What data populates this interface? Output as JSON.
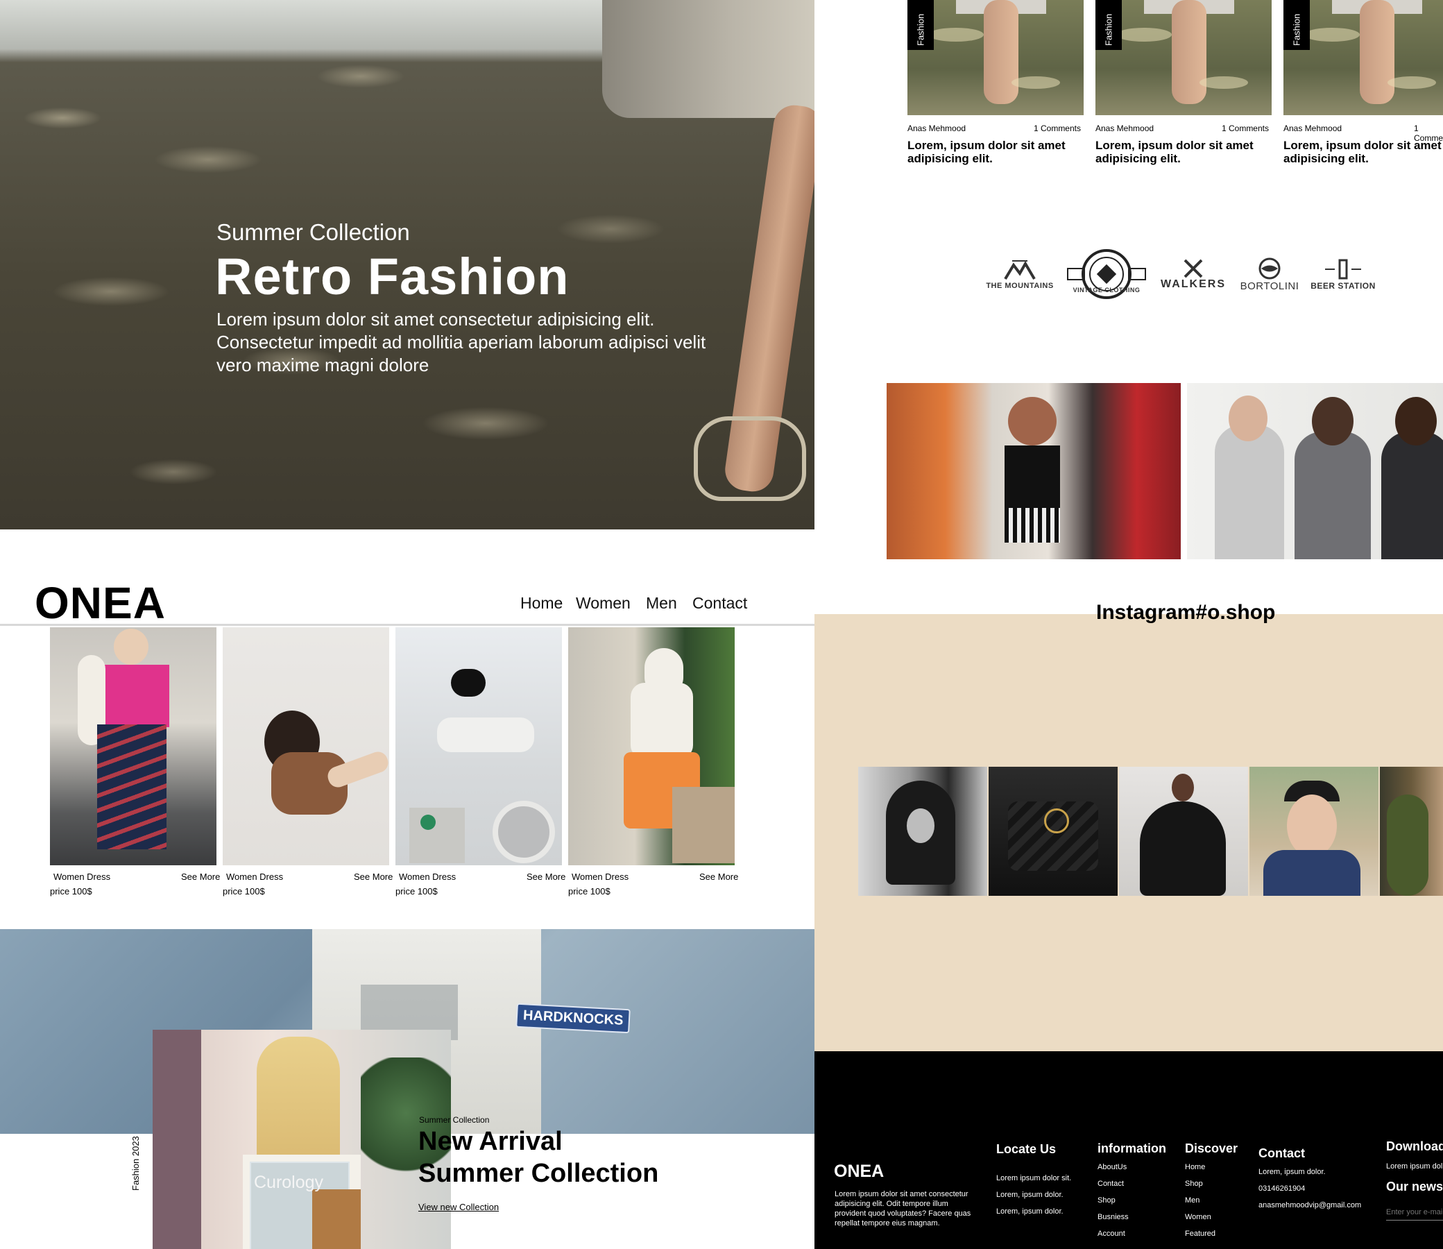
{
  "hero": {
    "kicker": "Summer Collection",
    "title": "Retro Fashion",
    "description": "Lorem ipsum dolor sit amet consectetur adipisicing elit. Consectetur impedit ad mollitia aperiam laborum adipisci velit vero maxime magni dolore"
  },
  "blog": {
    "cards": [
      {
        "tag": "Fashion",
        "author": "Anas Mehmood",
        "comments": "1 Comments",
        "title": "Lorem, ipsum dolor sit amet adipisicing elit."
      },
      {
        "tag": "Fashion",
        "author": "Anas Mehmood",
        "comments": "1 Comments",
        "title": "Lorem, ipsum dolor sit amet adipisicing elit."
      },
      {
        "tag": "Fashion",
        "author": "Anas Mehmood",
        "comments": "1 Comme",
        "title": "Lorem, ipsum dolor sit amet adipisicing elit."
      }
    ]
  },
  "brands": [
    {
      "name": "THE MOUNTAINS",
      "icon": "mountains-logo-icon"
    },
    {
      "name": "VINTAGE CLOTHING",
      "icon": "vintage-clothing-logo-icon"
    },
    {
      "name": "WALKERS",
      "icon": "walkers-logo-icon"
    },
    {
      "name": "BORTOLINI",
      "icon": "bortolini-logo-icon"
    },
    {
      "name": "BEER STATION",
      "icon": "beer-station-logo-icon"
    }
  ],
  "header": {
    "brand": "ONEA",
    "nav": [
      "Home",
      "Women",
      "Men",
      "Contact"
    ]
  },
  "products": [
    {
      "name": "Women Dress",
      "link": "See More",
      "price": "price 100$"
    },
    {
      "name": "Women Dress",
      "link": "See More",
      "price": "price 100$"
    },
    {
      "name": "Women Dress",
      "link": "See More",
      "price": "price 100$"
    },
    {
      "name": "Women Dress",
      "link": "See More",
      "price": "price 100$"
    }
  ],
  "arrival": {
    "patch": "HARDKNOCKS",
    "photo_text": "Curology",
    "side_label": "Fashion 2023",
    "kicker": "Summer Collection",
    "title_line1": "New Arrival",
    "title_line2": "Summer Collection",
    "link": "View new Collection"
  },
  "instagram": {
    "title": "Instagram#o.shop"
  },
  "footer": {
    "brand": "ONEA",
    "about": "Lorem ipsum dolor sit amet consectetur adipisicing elit. Odit tempore illum provident quod voluptates? Facere quas repellat tempore eius magnam.",
    "locate": {
      "title": "Locate Us",
      "items": [
        "Lorem ipsum dolor sit.",
        "Lorem, ipsum dolor.",
        "Lorem, ipsum dolor."
      ]
    },
    "information": {
      "title": "information",
      "items": [
        "AboutUs",
        "Contact",
        "Shop",
        "Busniess",
        "Account"
      ]
    },
    "discover": {
      "title": "Discover",
      "items": [
        "Home",
        "Shop",
        "Men",
        "Women",
        "Featured"
      ]
    },
    "contact": {
      "title": "Contact",
      "items": [
        "Lorem, ipsum dolor.",
        "03146261904",
        "anasmehmoodvip@gmail.com"
      ]
    },
    "download": {
      "title": "Download",
      "text": "Lorem ipsum dol"
    },
    "newsletter": {
      "title": "Our newsl",
      "placeholder": "Enter your e-mai"
    }
  },
  "colors": {
    "beige": "#ecdcc4",
    "footer": "#000000"
  }
}
